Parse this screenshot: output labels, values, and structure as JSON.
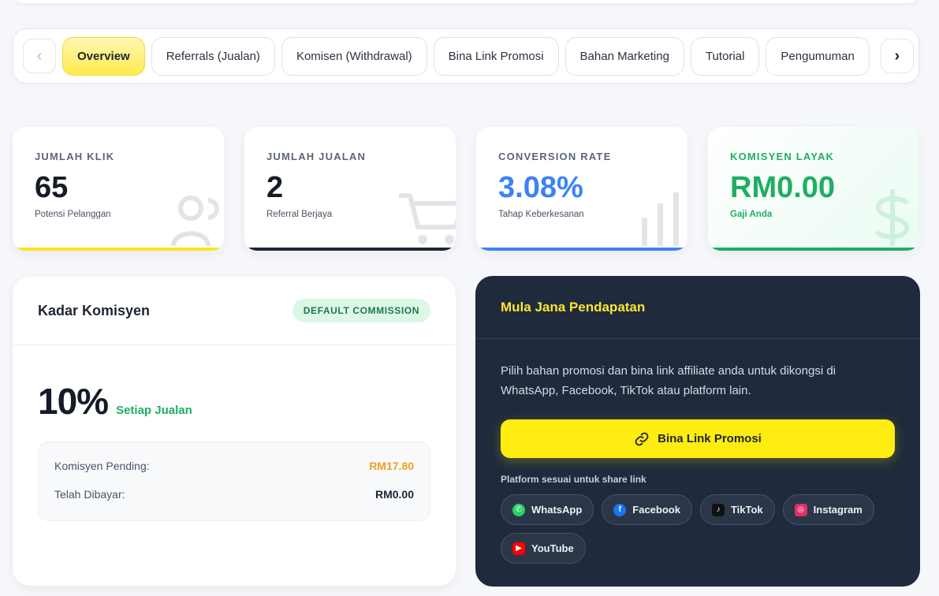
{
  "tabs": {
    "prev_symbol": "‹",
    "next_symbol": "›",
    "items": [
      {
        "label": "Overview",
        "active": true
      },
      {
        "label": "Referrals (Jualan)"
      },
      {
        "label": "Komisen (Withdrawal)"
      },
      {
        "label": "Bina Link Promosi"
      },
      {
        "label": "Bahan Marketing"
      },
      {
        "label": "Tutorial"
      },
      {
        "label": "Pengumuman"
      }
    ]
  },
  "stats": [
    {
      "label": "JUMLAH KLIK",
      "value": "65",
      "sub": "Potensi Pelanggan",
      "icon": "users-icon",
      "accent": "#ffe21a"
    },
    {
      "label": "JUMLAH JUALAN",
      "value": "2",
      "sub": "Referral Berjaya",
      "icon": "cart-icon",
      "accent": "#1e2533"
    },
    {
      "label": "CONVERSION RATE",
      "value": "3.08%",
      "sub": "Tahap Keberkesanan",
      "icon": "bar-chart-icon",
      "accent": "#3b82f6"
    },
    {
      "label": "KOMISYEN LAYAK",
      "value": "RM0.00",
      "sub": "Gaji Anda",
      "icon": "dollar-icon",
      "accent": "#1fae63"
    }
  ],
  "commission": {
    "title": "Kadar Komisyen",
    "badge": "DEFAULT COMMISSION",
    "rate": "10%",
    "rate_suffix": "Setiap Jualan",
    "pending_label": "Komisyen Pending:",
    "pending_value": "RM17.80",
    "paid_label": "Telah Dibayar:",
    "paid_value": "RM0.00"
  },
  "promo": {
    "title": "Mula Jana Pendapatan",
    "description": "Pilih bahan promosi dan bina link affiliate anda untuk dikongsi di WhatsApp, Facebook, TikTok atau platform lain.",
    "button_label": "Bina Link Promosi",
    "platform_label": "Platform sesuai untuk share link",
    "platforms": [
      {
        "name": "WhatsApp",
        "icon": "whatsapp-icon",
        "color": "#25d366"
      },
      {
        "name": "Facebook",
        "icon": "facebook-icon",
        "color": "#1877f2"
      },
      {
        "name": "TikTok",
        "icon": "tiktok-icon",
        "color": "#111111"
      },
      {
        "name": "Instagram",
        "icon": "instagram-icon",
        "color": "#e1306c"
      },
      {
        "name": "YouTube",
        "icon": "youtube-icon",
        "color": "#ff0000"
      }
    ]
  }
}
